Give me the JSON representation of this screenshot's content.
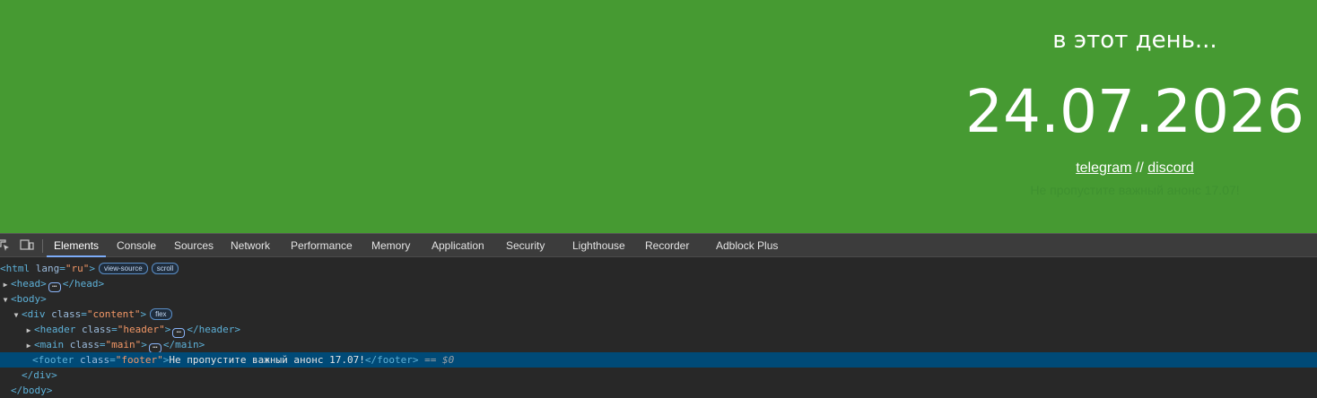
{
  "page": {
    "subtitle": "в этот день...",
    "date": "24.07.2026",
    "links": {
      "telegram": "telegram",
      "separator": "//",
      "discord": "discord"
    },
    "footer": "Не пропустите важный анонс 17.07!",
    "colors": {
      "background": "#469a32",
      "text": "#ffffff"
    }
  },
  "devtools": {
    "icons": [
      "inspect-element-icon",
      "device-toolbar-icon"
    ],
    "tabs": [
      "Elements",
      "Console",
      "Sources",
      "Network",
      "Performance",
      "Memory",
      "Application",
      "Security",
      "Lighthouse",
      "Recorder",
      "Adblock Plus"
    ],
    "active_tab": "Elements",
    "dom": {
      "html_open": "<html",
      "html_attr": "lang",
      "html_val": "\"ru\"",
      "html_badges": [
        "view-source",
        "scroll"
      ],
      "head_open": "<head>",
      "head_close": "</head>",
      "body_open": "<body>",
      "div_attr": "class",
      "div_val": "\"content\"",
      "div_badge": "flex",
      "header_val": "\"header\"",
      "header_close": "</header>",
      "main_val": "\"main\"",
      "main_close": "</main>",
      "footer_val": "\"footer\"",
      "footer_text": "Не пропустите важный анонс 17.07!",
      "footer_close": "</footer>",
      "selected_marker": "== $0",
      "div_close": "</div>",
      "body_close": "</body>"
    }
  }
}
